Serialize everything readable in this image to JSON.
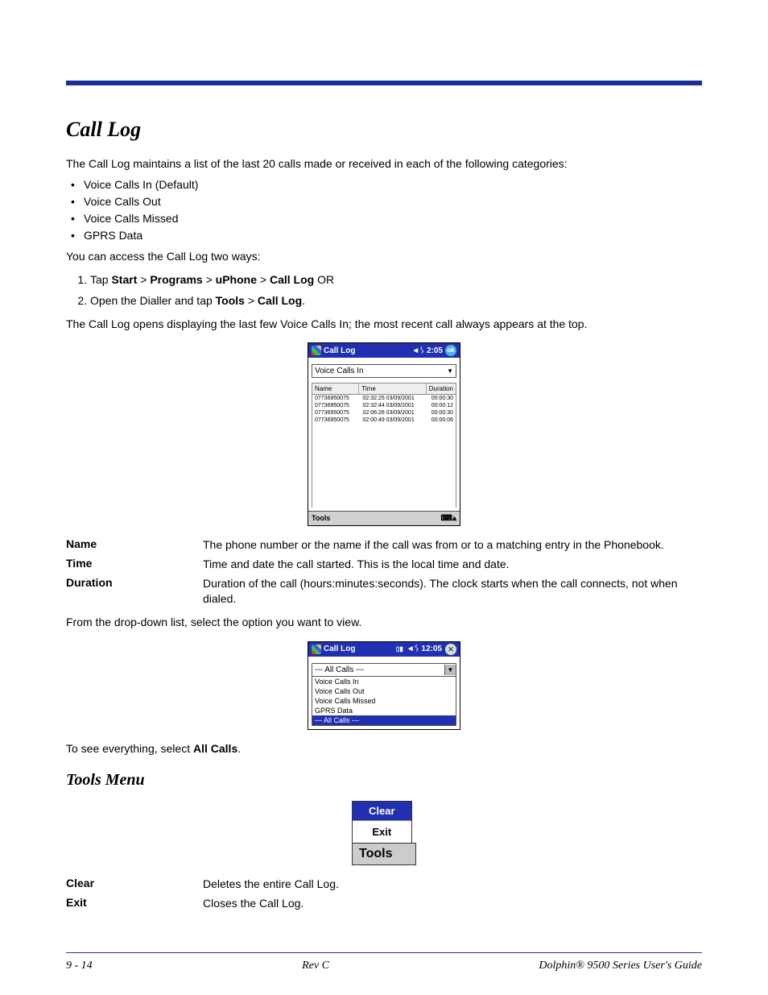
{
  "title": "Call Log",
  "intro": "The Call Log maintains a list of the last 20 calls made or received in each of the following categories:",
  "categories": [
    "Voice Calls In (Default)",
    "Voice Calls Out",
    "Voice Calls Missed",
    "GPRS Data"
  ],
  "access_intro": "You can access the Call Log two ways:",
  "step1": {
    "pre": "Tap ",
    "b1": "Start",
    "gt1": " > ",
    "b2": "Programs",
    "gt2": " > ",
    "b3": "uPhone",
    "gt3": " > ",
    "b4": "Call Log",
    "post": " OR"
  },
  "step2": {
    "pre": "Open the Dialler  and tap ",
    "b1": "Tools",
    "gt1": " > ",
    "b2": "Call Log",
    "post": "."
  },
  "opens": "The Call Log opens displaying the last few Voice Calls In; the most recent call always appears at the top.",
  "pda1": {
    "title": "Call Log",
    "time": "◄ᛊ 2:05",
    "ok": "ok",
    "combo": "Voice Calls In",
    "head": {
      "name": "Name",
      "time": "Time",
      "dur": "Duration"
    },
    "rows": [
      {
        "n": "07736950075",
        "t": "02:32:25 03/09/2001",
        "d": "00:00:30"
      },
      {
        "n": "07736950075",
        "t": "02:32:44 03/09/2001",
        "d": "00:00:12"
      },
      {
        "n": "07736950075",
        "t": "02:06:26 03/09/2001",
        "d": "00:00:30"
      },
      {
        "n": "07736950075",
        "t": "02:00:49 03/09/2001",
        "d": "00:00:06"
      }
    ],
    "tools": "Tools"
  },
  "defs1": [
    {
      "term": "Name",
      "desc": "The phone number or the name if the call was from or to a matching entry in the Phonebook."
    },
    {
      "term": "Time",
      "desc": "Time and date the call started. This is the local time and date."
    },
    {
      "term": "Duration",
      "desc": "Duration of the call (hours:minutes:seconds). The clock starts when the call connects, not when dialed."
    }
  ],
  "dropdown_note": "From the drop-down list, select the option you want to view.",
  "pda2": {
    "title": "Call Log",
    "time": "◄ᛊ 12:05",
    "sig": "▯▮",
    "selected": "--- All Calls ---",
    "options": [
      "Voice Calls In",
      "Voice Calls Out",
      "Voice Calls Missed",
      "GPRS Data",
      "--- All Calls ---"
    ]
  },
  "allcalls": {
    "pre": "To see everything, select ",
    "b": "All Calls",
    "post": "."
  },
  "tools_menu_title": "Tools Menu",
  "menu": {
    "clear": "Clear",
    "exit": "Exit",
    "tools": "Tools"
  },
  "defs2": [
    {
      "term": "Clear",
      "desc": "Deletes the entire Call Log."
    },
    {
      "term": "Exit",
      "desc": "Closes the Call Log."
    }
  ],
  "footer": {
    "left": "9 - 14",
    "center": "Rev C",
    "right": "Dolphin® 9500 Series User's Guide"
  }
}
